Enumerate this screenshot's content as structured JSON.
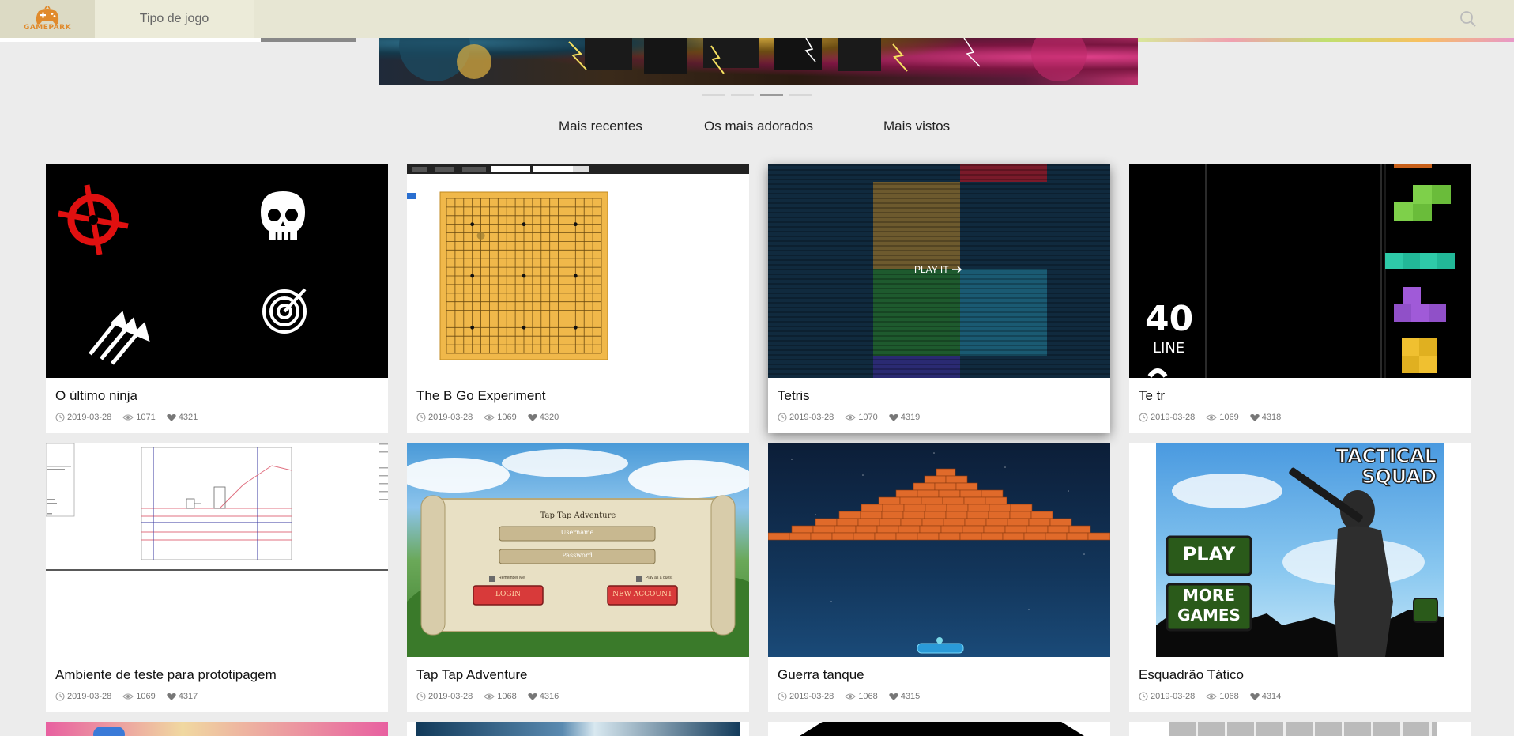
{
  "header": {
    "logo_text": "GAMEPARK",
    "nav_label": "Tipo de jogo"
  },
  "filters": [
    "Mais recentes",
    "Os mais adorados",
    "Mais vistos"
  ],
  "carousel": {
    "slides": 4,
    "active_index": 2
  },
  "cards": [
    {
      "title": "O último ninja",
      "date": "2019-03-28",
      "views": "1071",
      "likes": "4321"
    },
    {
      "title": "The B Go Experiment",
      "date": "2019-03-28",
      "views": "1069",
      "likes": "4320"
    },
    {
      "title": "Tetris",
      "date": "2019-03-28",
      "views": "1070",
      "likes": "4319",
      "overlay": "PLAY IT"
    },
    {
      "title": "Te tr",
      "date": "2019-03-28",
      "views": "1069",
      "likes": "4318",
      "score": "40",
      "score_label": "LINE"
    },
    {
      "title": "Ambiente de teste para prototipagem",
      "date": "2019-03-28",
      "views": "1069",
      "likes": "4317"
    },
    {
      "title": "Tap Tap Adventure",
      "date": "2019-03-28",
      "views": "1068",
      "likes": "4316",
      "panel": {
        "heading": "Tap Tap Adventure",
        "username": "Username",
        "password": "Password",
        "remember": "Remember Me",
        "guest": "Play as a guest",
        "login": "LOGIN",
        "new_account": "NEW ACCOUNT"
      }
    },
    {
      "title": "Guerra tanque",
      "date": "2019-03-28",
      "views": "1068",
      "likes": "4315"
    },
    {
      "title": "Esquadrão Tático",
      "date": "2019-03-28",
      "views": "1068",
      "likes": "4314",
      "art": {
        "logo_line1": "TACTICAL",
        "logo_line2": "SQUAD",
        "play": "PLAY",
        "more1": "MORE",
        "more2": "GAMES"
      }
    }
  ],
  "colors": {
    "header_bg": "#e7e6d3",
    "page_bg": "#ececec",
    "logo_orange": "#e08a2c",
    "go_board": "#f0b84a"
  }
}
